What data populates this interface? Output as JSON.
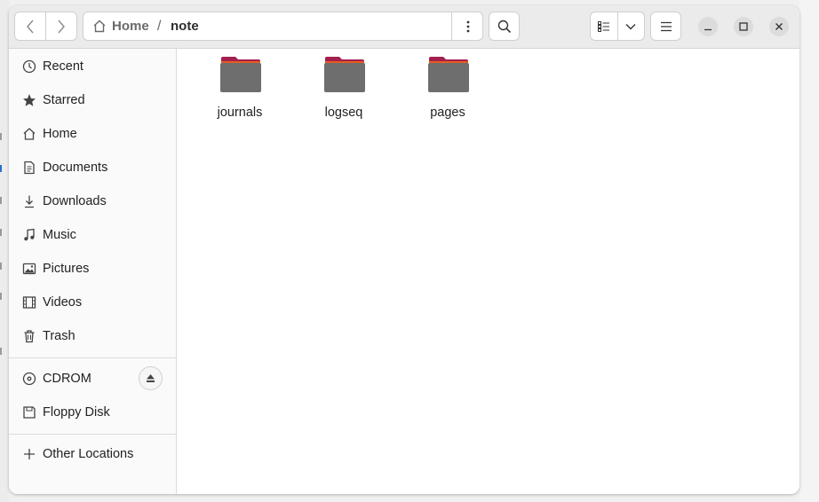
{
  "colors": {
    "folder_body": "#6e6e6e",
    "folder_tab": "#a3204e",
    "folder_accent": "#e65c20"
  },
  "navigation": {
    "back_icon": "chevron-left-icon",
    "forward_icon": "chevron-right-icon"
  },
  "pathbar": {
    "home_label": "Home",
    "separator": "/",
    "current_label": "note",
    "menu_icon": "vertical-dots-icon"
  },
  "toolbar": {
    "search_icon": "search-icon",
    "list_view_icon": "list-view-icon",
    "view_options_icon": "chevron-down-icon",
    "menu_icon": "hamburger-icon"
  },
  "window_controls": {
    "minimize": "minimize-icon",
    "maximize": "maximize-icon",
    "close": "close-icon"
  },
  "sidebar": {
    "items": [
      {
        "label": "Recent",
        "icon": "clock-icon"
      },
      {
        "label": "Starred",
        "icon": "star-icon"
      },
      {
        "label": "Home",
        "icon": "home-icon"
      },
      {
        "label": "Documents",
        "icon": "document-icon"
      },
      {
        "label": "Downloads",
        "icon": "download-icon"
      },
      {
        "label": "Music",
        "icon": "music-icon"
      },
      {
        "label": "Pictures",
        "icon": "picture-icon"
      },
      {
        "label": "Videos",
        "icon": "video-icon"
      },
      {
        "label": "Trash",
        "icon": "trash-icon"
      }
    ],
    "devices": [
      {
        "label": "CDROM",
        "icon": "disc-icon",
        "eject_icon": "eject-icon"
      },
      {
        "label": "Floppy Disk",
        "icon": "floppy-icon"
      }
    ],
    "other_locations": {
      "label": "Other Locations",
      "icon": "plus-icon"
    }
  },
  "files": [
    {
      "name": "journals",
      "icon": "folder-icon"
    },
    {
      "name": "logseq",
      "icon": "folder-icon"
    },
    {
      "name": "pages",
      "icon": "folder-icon"
    }
  ]
}
